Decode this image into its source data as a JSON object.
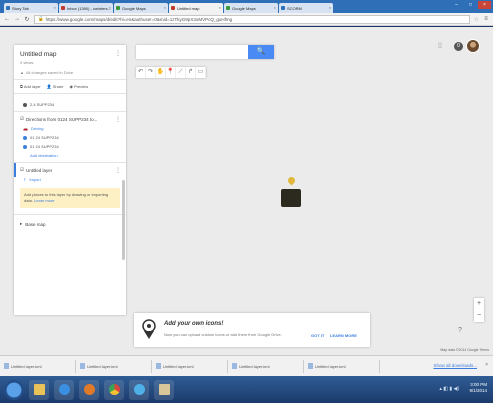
{
  "browser": {
    "tabs": [
      {
        "label": "Story Tab",
        "color": "#2e6fb7"
      },
      {
        "label": "Inbox (1390) - cwinters...",
        "color": "#c23a2b"
      },
      {
        "label": "Google Maps",
        "color": "#3a9a3a"
      },
      {
        "label": "Untitled map",
        "color": "#c23a2b"
      },
      {
        "label": "Google Maps",
        "color": "#3a9a3a"
      },
      {
        "label": "SCORM",
        "color": "#2e6fb7"
      }
    ],
    "url_scheme": "https",
    "url": "https://www.google.com/maps/d/edit?hl=en&authuser=0&mid=1zTkyG9pX3oMVPcQ_guHfmg"
  },
  "panel": {
    "title": "Untitled map",
    "views": "0 views",
    "saved": "All changes saved in Drive",
    "actions": {
      "add_layer": "Add layer",
      "share": "Share",
      "preview": "Preview"
    },
    "route_item": "2,4 SUPP234",
    "directions": {
      "title": "Directions from 0124 SUPP234 to...",
      "mode": "Driving",
      "stops": [
        "01 24 SUPP234",
        "01 24 SUPP234"
      ],
      "add_destination": "Add destination"
    },
    "layer": {
      "title": "Untitled layer",
      "import": "Import",
      "hint": "Add places to this layer by drawing or importing data.",
      "learn_more": "Learn more"
    },
    "base_map": "Base map"
  },
  "search": {
    "placeholder": "",
    "button": "🔍"
  },
  "tip": {
    "title": "Add your own icons!",
    "text": "Now you can upload custom icons or add them from Google Drive.",
    "got_it": "GOT IT",
    "learn_more": "LEARN MORE"
  },
  "zoom": {
    "plus": "+",
    "minus": "−"
  },
  "attribution": "Map data ©2014 Google  Terms",
  "notifications": "0",
  "downloads": {
    "items": [
      "Untitled layer.kml",
      "Untitled layer.kml",
      "Untitled layer.kml",
      "Untitled layer.kml",
      "Untitled layer.kml"
    ],
    "show_all": "Show all downloads..."
  },
  "clock": {
    "time": "3:00 PM",
    "date": "9/1/2014"
  }
}
